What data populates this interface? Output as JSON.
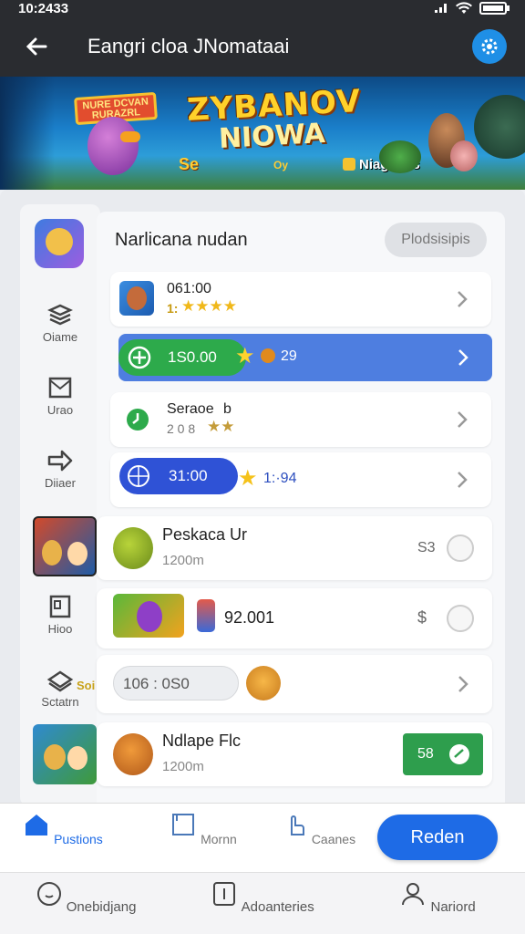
{
  "status": {
    "time": "10:2433"
  },
  "appbar": {
    "title": "Eangri cloa JNomataai"
  },
  "banner": {
    "small_sign": "NURE DCVAN RURAZRL",
    "logo_main": "ZYBANOV",
    "logo_sub": "NIOWA",
    "tag_a": "Se",
    "tag_b": "Oy",
    "tag_c": "Niagenas"
  },
  "sidebar": {
    "items": [
      {
        "label": "Oiame",
        "icon": "layers-icon"
      },
      {
        "label": "Urao",
        "icon": "envelope-icon"
      },
      {
        "label": "Diiaer",
        "icon": "share-arrow-icon"
      },
      {
        "label": "Hioo",
        "icon": "document-icon"
      },
      {
        "label": "Sctatrn",
        "icon": "inbox-tray-icon"
      }
    ]
  },
  "main": {
    "header": "Narlicana nudan",
    "header_button": "Plodsisipis"
  },
  "rows": [
    {
      "time": "061:00",
      "rating": "1:",
      "icon": "game-character-icon"
    },
    {
      "pill_value": "1S0.00",
      "count": "29"
    },
    {
      "label": "Seraoe",
      "suffix": "b",
      "sub": "2 0 8"
    },
    {
      "pill_value": "31:00",
      "value": "1:·94"
    }
  ],
  "cards": [
    {
      "title": "Peskaca Ur",
      "sub": "1200m",
      "price": "S3"
    },
    {
      "title": "92.001",
      "price": "$"
    },
    {
      "pill": "106 : 0S0"
    },
    {
      "title": "Ndlape Flc",
      "sub": "1200m",
      "button": "58"
    }
  ],
  "side_badge": "Soi",
  "bottomnav": {
    "items": [
      "Pustions",
      "Mornn",
      "Caanes"
    ],
    "primary": "Reden"
  },
  "sysbar": {
    "items": [
      "Onebidjang",
      "Adoanteries",
      "Nariord"
    ]
  },
  "colors": {
    "accent": "#1e6be6",
    "green": "#2daa4b",
    "appbar": "#2a2c30"
  }
}
